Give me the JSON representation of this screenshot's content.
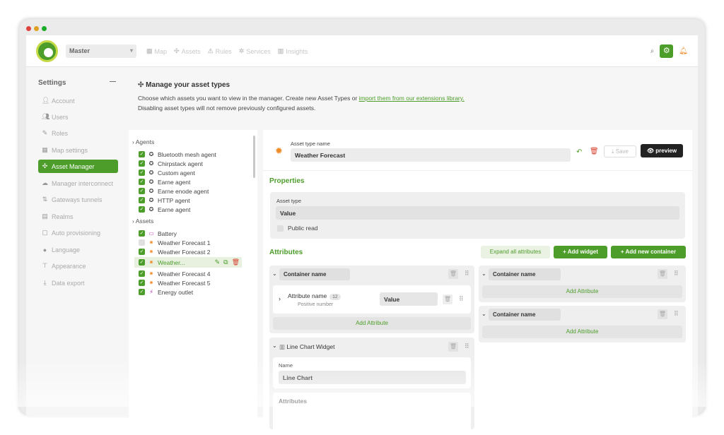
{
  "header": {
    "realm": "Master",
    "nav": [
      {
        "label": "Map",
        "icon": "map-icon"
      },
      {
        "label": "Assets",
        "icon": "assets-icon"
      },
      {
        "label": "Rules",
        "icon": "rules-icon"
      },
      {
        "label": "Services",
        "icon": "services-icon"
      },
      {
        "label": "Insights",
        "icon": "insights-icon"
      }
    ]
  },
  "sidebar": {
    "title": "Settings",
    "items": [
      {
        "label": "Account"
      },
      {
        "label": "Users"
      },
      {
        "label": "Roles"
      },
      {
        "label": "Map settings"
      },
      {
        "label": "Asset Manager",
        "active": true
      },
      {
        "label": "Manager interconnect"
      },
      {
        "label": "Gateways tunnels"
      },
      {
        "label": "Realms"
      },
      {
        "label": "Auto provisioning"
      },
      {
        "label": "Language"
      },
      {
        "label": "Appearance"
      },
      {
        "label": "Data export"
      }
    ]
  },
  "intro": {
    "title": "Manage your asset types",
    "line1": "Choose which assets you want to view in the manager. Create new Asset Types or ",
    "link": "import them from our extensions library.",
    "line2": "Disabling asset types will not remove previously configured assets."
  },
  "list": {
    "agents_label": "Agents",
    "agents": [
      "Bluetooth mesh agent",
      "Chirpstack agent",
      "Custom agent",
      "Earne agent",
      "Earne enode agent",
      "HTTP agent",
      "Earne agent"
    ],
    "assets_label": "Assets",
    "assets": [
      {
        "label": "Battery",
        "checked": true
      },
      {
        "label": "Weather Forecast 1",
        "checked": false
      },
      {
        "label": "Weather Forecast 2",
        "checked": true
      },
      {
        "label": "Weather...",
        "checked": true,
        "selected": true
      },
      {
        "label": "Weather Forecast 4",
        "checked": true
      },
      {
        "label": "Weather Forecast 5",
        "checked": true
      },
      {
        "label": "Energy outlet",
        "checked": true
      }
    ]
  },
  "detail": {
    "type_name_label": "Asset type name",
    "type_name": "Weather Forecast",
    "save": "Save",
    "preview": "preview",
    "properties": "Properties",
    "asset_type_label": "Asset type",
    "asset_type_value": "Value",
    "read_only": "Public read",
    "attributes": "Attributes",
    "expand_all": "Expand all attributes",
    "add_widget": "Add widget",
    "add_container": "Add new container",
    "container_name": "Container name",
    "attribute_name": "Attribute name",
    "attribute_badge": "12",
    "attribute_sub": "Positive number",
    "attribute_value": "Value",
    "add_attribute": "Add Attribute",
    "widget_title": "Line Chart Widget",
    "name_label": "Name",
    "name_value": "Line Chart",
    "attributes_sub": "Attributes"
  }
}
